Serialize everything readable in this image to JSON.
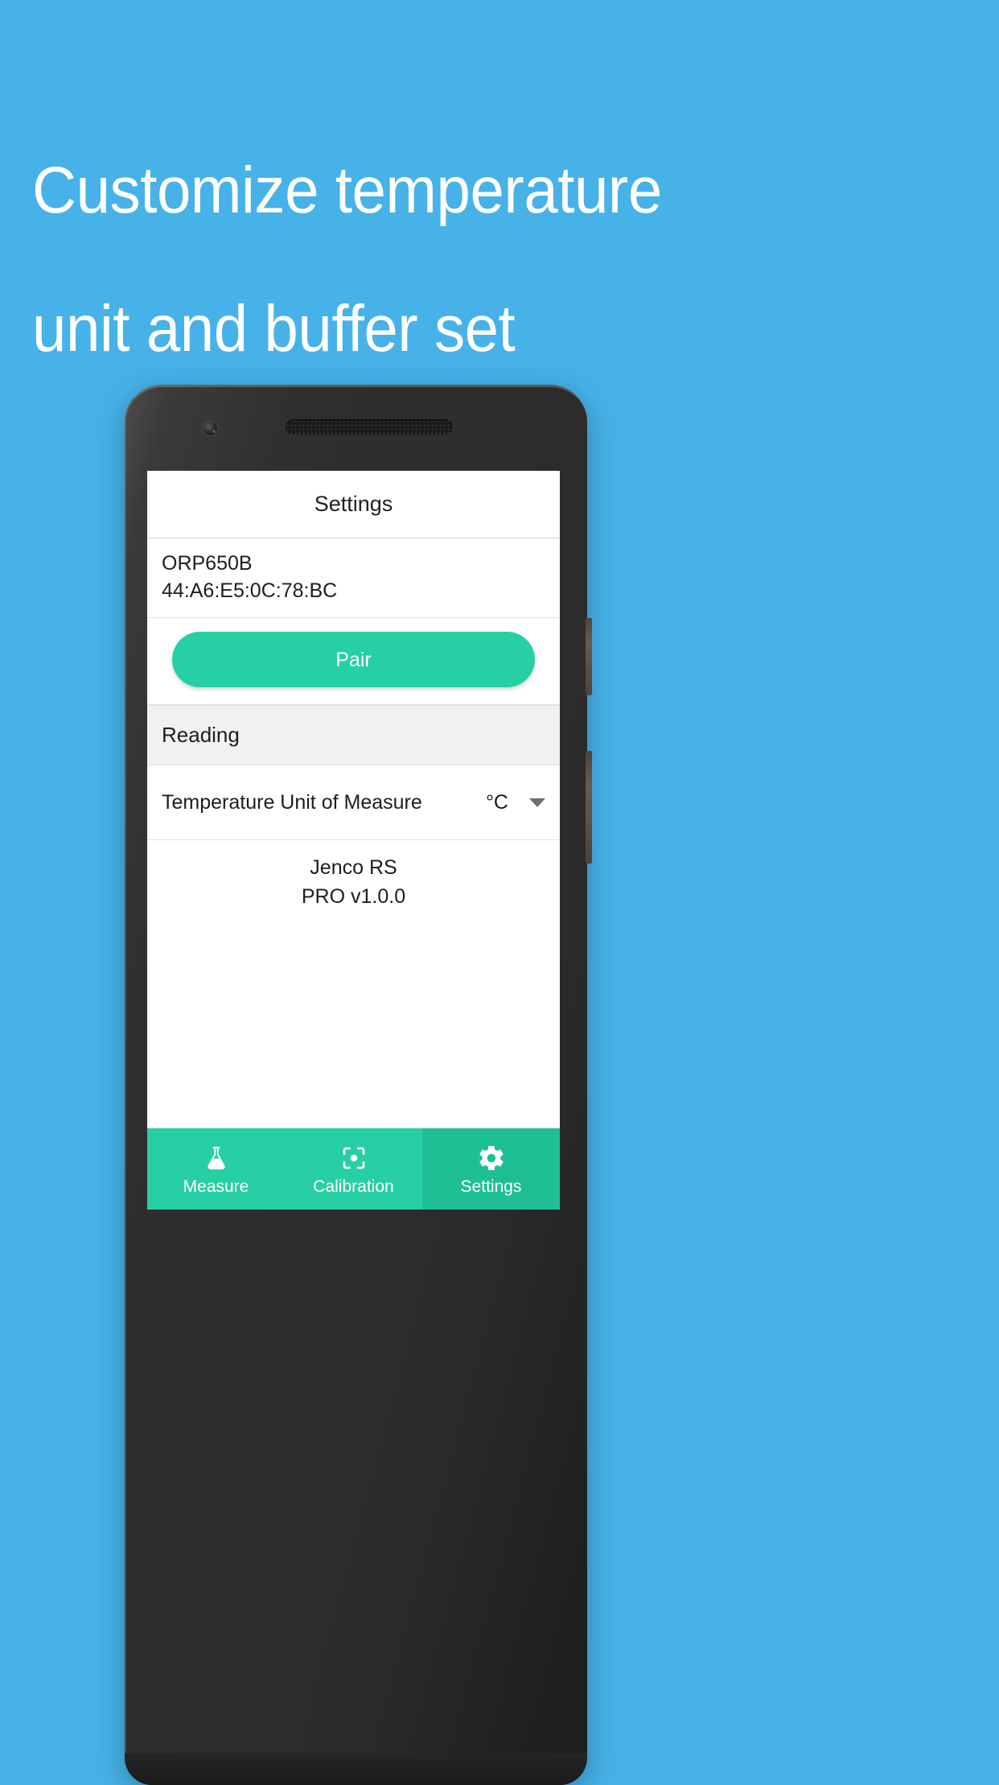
{
  "promo": {
    "headline_line1": "Customize temperature",
    "headline_line2": "unit and buffer set",
    "background_color": "#46b2e8",
    "text_color": "#ffffff"
  },
  "app": {
    "titlebar": {
      "title": "Settings"
    },
    "device": {
      "name": "ORP650B",
      "mac_address": "44:A6:E5:0C:78:BC"
    },
    "pair_button": {
      "label": "Pair",
      "color": "#27cfa4"
    },
    "sections": [
      {
        "header": "Reading",
        "rows": [
          {
            "label": "Temperature Unit of Measure",
            "value": "°C",
            "control": "chevron-down-icon"
          }
        ]
      }
    ],
    "footer": {
      "app_name": "Jenco RS",
      "version": "PRO v1.0.0"
    },
    "tabbar": {
      "active_color": "#1fbf96",
      "color": "#27cfa4",
      "tabs": [
        {
          "label": "Measure",
          "icon": "flask-icon",
          "active": false
        },
        {
          "label": "Calibration",
          "icon": "focus-target-icon",
          "active": false
        },
        {
          "label": "Settings",
          "icon": "gear-icon",
          "active": true
        }
      ]
    }
  },
  "device_frame": {
    "camera": "front-camera",
    "speaker": "earpiece-speaker"
  }
}
